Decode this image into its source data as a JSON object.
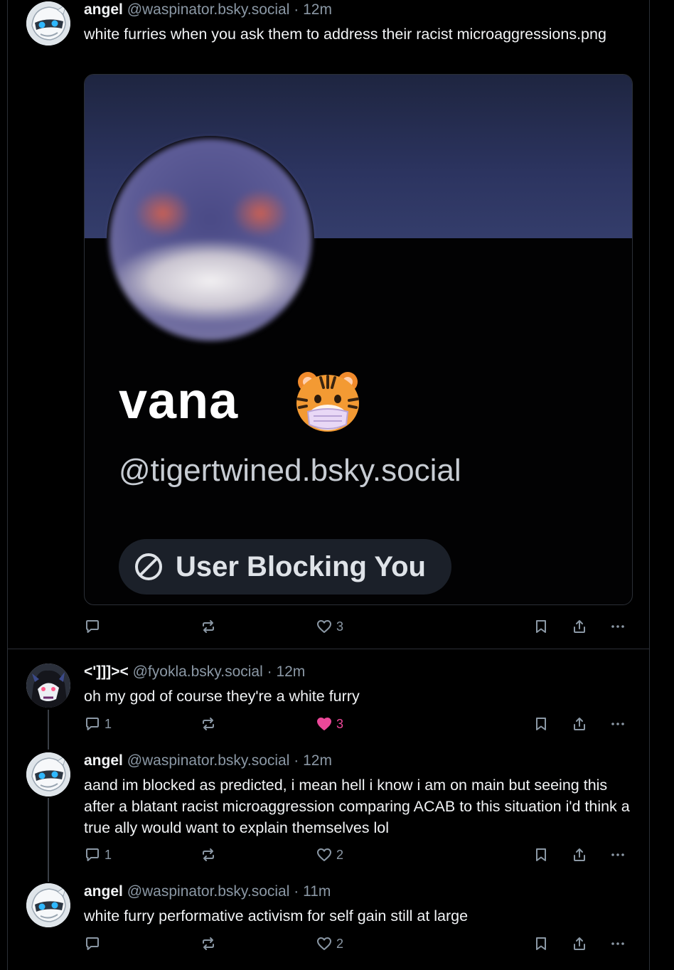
{
  "posts": [
    {
      "name": "angel",
      "handle": "@waspinator.bsky.social",
      "separator": "·",
      "time": "12m",
      "text": "white furries when you ask them to address their racist microaggressions.png",
      "avatar_icon": "robot-avatar",
      "embed": {
        "display_name": "vana",
        "handle": "@tigertwined.bsky.social",
        "badge": "User Blocking You",
        "emoji_icon": "tiger-face-with-mask-icon"
      },
      "reply_count": "",
      "like_count": "3",
      "liked": false
    },
    {
      "name": "<']]]><",
      "handle": "@fyokla.bsky.social",
      "separator": "·",
      "time": "12m",
      "text": "oh my god of course they're a white furry",
      "avatar_icon": "wolf-avatar",
      "reply_count": "1",
      "like_count": "3",
      "liked": true
    },
    {
      "name": "angel",
      "handle": "@waspinator.bsky.social",
      "separator": "·",
      "time": "12m",
      "text": "aand im blocked as predicted, i mean hell i know i am on main but seeing this after a blatant racist microaggression comparing ACAB to this situation i'd think a true ally would want to explain themselves lol",
      "avatar_icon": "robot-avatar",
      "reply_count": "1",
      "like_count": "2",
      "liked": false
    },
    {
      "name": "angel",
      "handle": "@waspinator.bsky.social",
      "separator": "·",
      "time": "11m",
      "text": "white furry performative activism for self gain still at large",
      "avatar_icon": "robot-avatar",
      "reply_count": "",
      "like_count": "2",
      "liked": false
    }
  ],
  "colors": {
    "background": "#000000",
    "muted": "#8b98a5",
    "like_active": "#ec4899",
    "border": "#2b2f36"
  }
}
